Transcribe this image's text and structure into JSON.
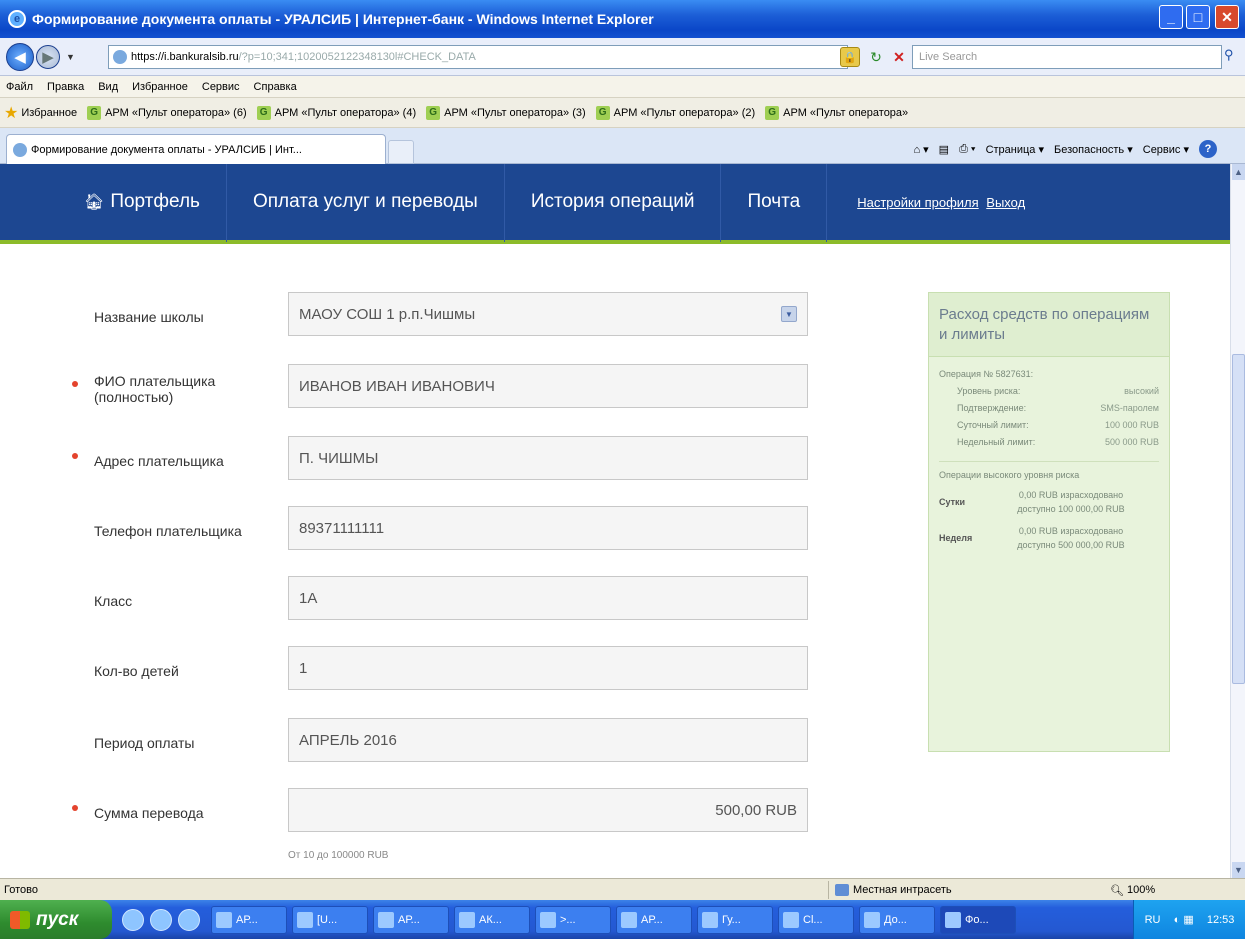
{
  "window": {
    "title": "Формирование документа оплаты - УРАЛСИБ | Интернет-банк - Windows Internet Explorer"
  },
  "address": {
    "host": "https://i.bankuralsib.ru",
    "path": "/?p=10;341;1020052122348130l#CHECK_DATA",
    "search_placeholder": "Live Search"
  },
  "menubar": [
    "Файл",
    "Правка",
    "Вид",
    "Избранное",
    "Сервис",
    "Справка"
  ],
  "favorites": {
    "label": "Избранное",
    "items": [
      "АРМ «Пульт оператора» (6)",
      "АРМ «Пульт оператора» (4)",
      "АРМ «Пульт оператора» (3)",
      "АРМ «Пульт оператора» (2)",
      "АРМ «Пульт оператора»"
    ]
  },
  "tab": {
    "title": "Формирование документа оплаты - УРАЛСИБ | Инт..."
  },
  "commandbar": {
    "page": "Страница ▾",
    "safety": "Безопасность ▾",
    "tools": "Сервис ▾"
  },
  "sitenav": {
    "portfolio": "Портфель",
    "payments": "Оплата услуг и переводы",
    "history": "История операций",
    "mail": "Почта",
    "profile": "Настройки профиля",
    "logout": "Выход"
  },
  "form": {
    "fields": [
      {
        "label": "Название школы",
        "value": "МАОУ СОШ 1 р.п.Чишмы",
        "required": false
      },
      {
        "label": "ФИО плательщика (полностью)",
        "value": "ИВАНОВ ИВАН ИВАНОВИЧ",
        "required": true
      },
      {
        "label": "Адрес плательщика",
        "value": "П. ЧИШМЫ",
        "required": true
      },
      {
        "label": "Телефон плательщика",
        "value": "89371111111",
        "required": false
      },
      {
        "label": "Класс",
        "value": "1А",
        "required": false
      },
      {
        "label": "Кол-во детей",
        "value": "1",
        "required": false
      },
      {
        "label": "Период оплаты",
        "value": "АПРЕЛЬ 2016",
        "required": false
      },
      {
        "label": "Сумма перевода",
        "value": "500,00 RUB",
        "required": true
      }
    ],
    "amount_hint": "От 10 до 100000 RUB"
  },
  "panel": {
    "title": "Расход средств по операциям и лимиты",
    "operation_title": "Операция № 5827631:",
    "details": [
      {
        "k": "Уровень риска:",
        "v": "высокий"
      },
      {
        "k": "Подтверждение:",
        "v": "SMS-паролем"
      },
      {
        "k": "Суточный лимит:",
        "v": "100 000 RUB"
      },
      {
        "k": "Недельный лимит:",
        "v": "500 000 RUB"
      }
    ],
    "high_risk_title": "Операции высокого уровня риска",
    "periods": [
      {
        "k": "Сутки",
        "spent": "0,00 RUB израсходовано",
        "avail": "доступно 100 000,00 RUB"
      },
      {
        "k": "Неделя",
        "spent": "0,00 RUB израсходовано",
        "avail": "доступно 500 000,00 RUB"
      }
    ]
  },
  "statusbar": {
    "left": "Готово",
    "zone": "Местная интрасеть",
    "zoom": "100%"
  },
  "taskbar": {
    "start": "пуск",
    "tasks": [
      "АР...",
      "[U...",
      "АР...",
      "АК...",
      ">...",
      "АР...",
      "Гу...",
      "Cl...",
      "До...",
      "Фо..."
    ],
    "lang": "RU",
    "clock": "12:53"
  }
}
